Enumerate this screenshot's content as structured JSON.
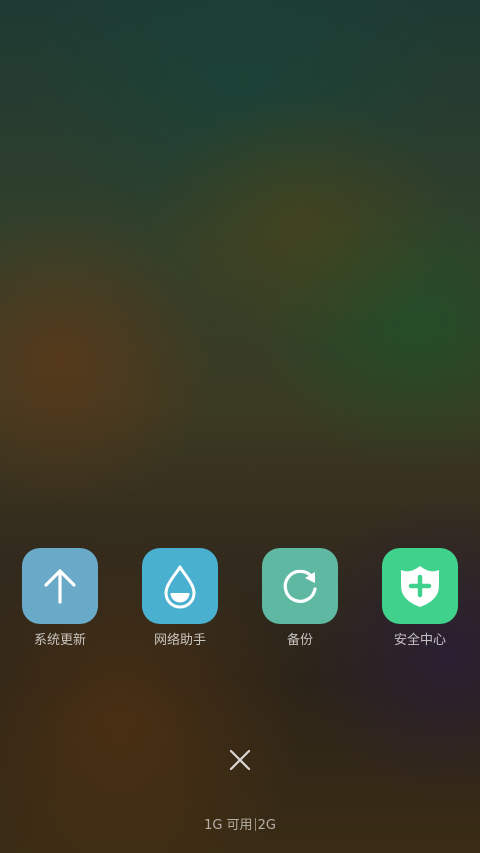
{
  "apps": [
    {
      "label": "系统更新",
      "icon": "arrow-up-icon",
      "color": "#6aaac9"
    },
    {
      "label": "网络助手",
      "icon": "water-drop-icon",
      "color": "#4ab0cf"
    },
    {
      "label": "备份",
      "icon": "refresh-icon",
      "color": "#5fb9a2"
    },
    {
      "label": "安全中心",
      "icon": "shield-plus-icon",
      "color": "#40d28d"
    }
  ],
  "close": {
    "icon": "close-icon"
  },
  "memory": {
    "available": "1G 可用",
    "total": "2G"
  }
}
